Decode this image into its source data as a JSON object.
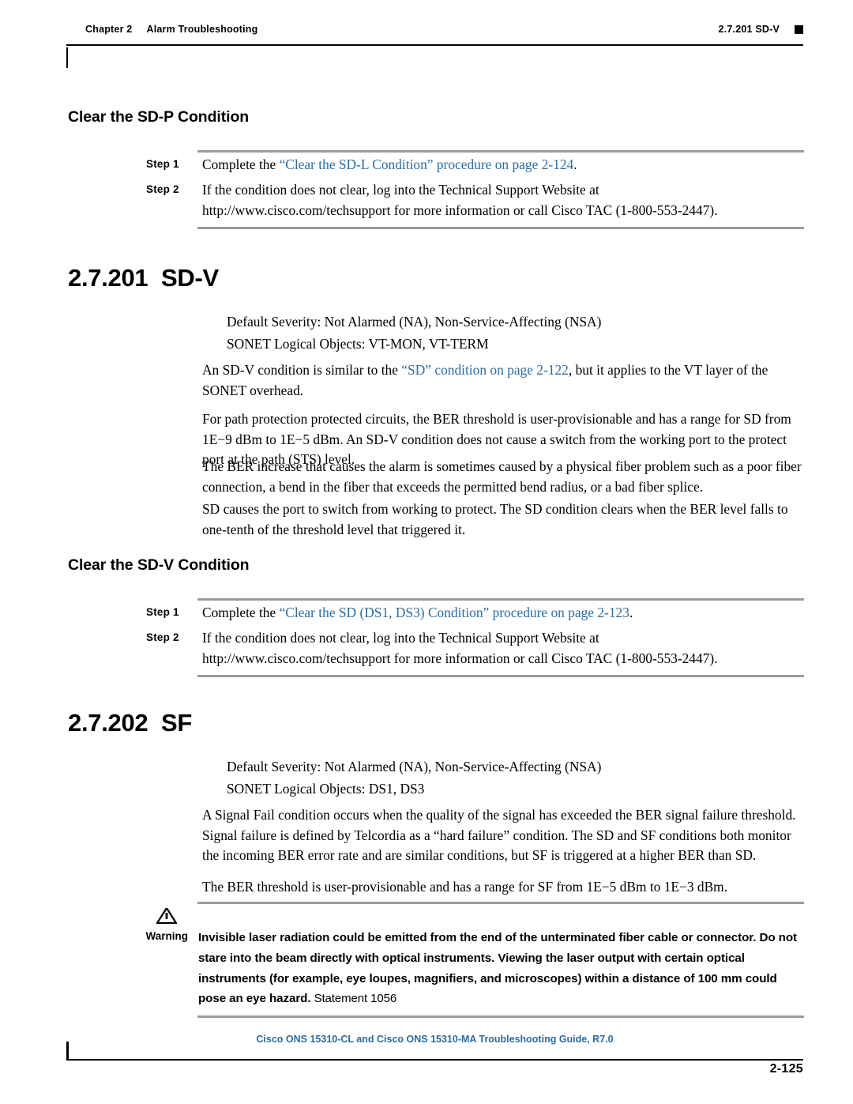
{
  "header": {
    "chapter_number": "Chapter 2",
    "chapter_title": "Alarm Troubleshooting",
    "right_ref": "2.7.201  SD-V"
  },
  "sections": {
    "sd_p": {
      "heading": "Clear the SD-P Condition",
      "steps": [
        {
          "label": "Step 1",
          "text_before": "Complete the ",
          "link": "“Clear the SD-L Condition” procedure on page 2-124",
          "text_after": "."
        },
        {
          "label": "Step 2",
          "line1": "If the condition does not clear, log into the Technical Support Website at",
          "line2": "http://www.cisco.com/techsupport for more information or call Cisco TAC (1-800-553-2447)."
        }
      ]
    },
    "sd_v": {
      "number": "2.7.201",
      "title": "SD-V",
      "severity": "Default Severity: Not Alarmed (NA), Non-Service-Affecting (NSA)",
      "logical_objects": "SONET Logical Objects: VT-MON, VT-TERM",
      "p1_before": "An SD-V condition is similar to the ",
      "p1_link": "“SD” condition on page 2-122",
      "p1_after": ", but it applies to the VT layer of the SONET overhead.",
      "p2": "For path protection protected circuits, the BER threshold is user-provisionable and has a range for SD from 1E−9 dBm to 1E−5 dBm. An SD-V condition does not cause a switch from the working port to the protect port at the path (STS) level.",
      "p3": "The BER increase that causes the alarm is sometimes caused by a physical fiber problem such as a poor fiber connection, a bend in the fiber that exceeds the permitted bend radius, or a bad fiber splice.",
      "p4": "SD causes the port to switch from working to protect. The SD condition clears when the BER level falls to one-tenth of the threshold level that triggered it."
    },
    "clear_sd_v": {
      "heading": "Clear the SD-V Condition",
      "steps": [
        {
          "label": "Step 1",
          "text_before": "Complete the ",
          "link": "“Clear the SD (DS1, DS3) Condition” procedure on page 2-123",
          "text_after": "."
        },
        {
          "label": "Step 2",
          "line1": "If the condition does not clear, log into the Technical Support Website at",
          "line2": "http://www.cisco.com/techsupport for more information or call Cisco TAC (1-800-553-2447)."
        }
      ]
    },
    "sf": {
      "number": "2.7.202",
      "title": "SF",
      "severity": "Default Severity: Not Alarmed (NA), Non-Service-Affecting (NSA)",
      "logical_objects": "SONET Logical Objects: DS1, DS3",
      "p1": "A Signal Fail condition occurs when the quality of the signal has exceeded the BER signal failure threshold. Signal failure is defined by Telcordia as a “hard failure” condition. The SD and SF conditions both monitor the incoming BER error rate and are similar conditions, but SF is triggered at a higher BER than SD.",
      "p2": "The BER threshold is user-provisionable and has a range for SF from 1E−5 dBm to 1E−3 dBm."
    }
  },
  "warning": {
    "label": "Warning",
    "body": "Invisible laser radiation could be emitted from the end of the unterminated fiber cable or connector. Do not stare into the beam directly with optical instruments. Viewing the laser output with certain optical instruments (for example, eye loupes, magnifiers, and microscopes) within a distance of 100 mm could pose an eye hazard.",
    "statement": "Statement 1056"
  },
  "footer": {
    "title": "Cisco ONS 15310-CL and Cisco ONS 15310-MA Troubleshooting Guide, R7.0",
    "page_number": "2-125"
  },
  "colors": {
    "link": "#2b6ca3",
    "rule": "#9b9b9b"
  }
}
